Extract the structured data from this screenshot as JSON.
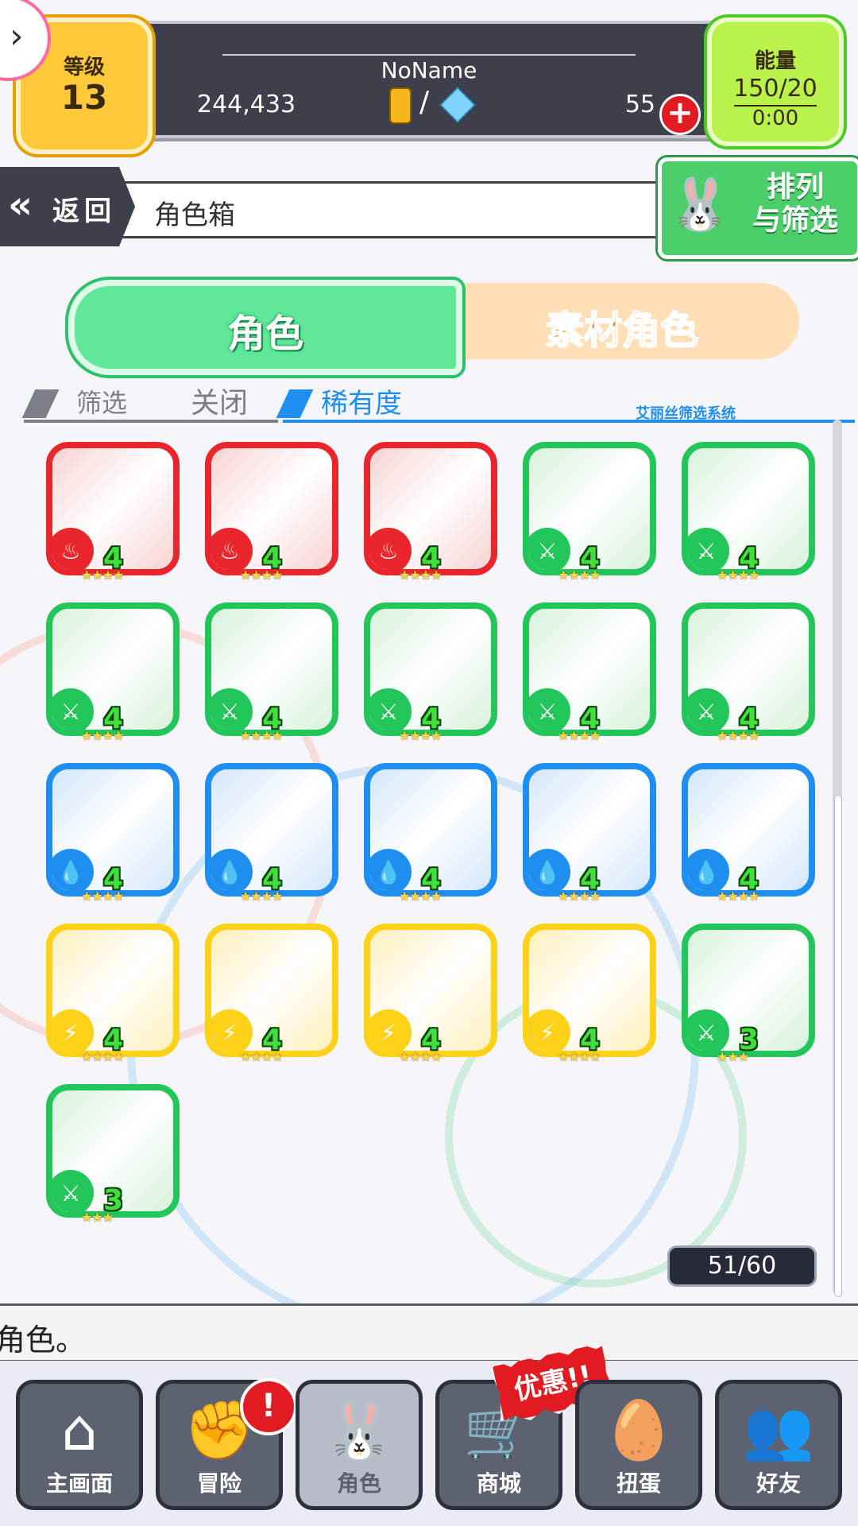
{
  "header": {
    "player_name": "NoName",
    "level_label": "等级",
    "level_value": "13",
    "gold": "244,433",
    "separator": "/",
    "gems": "55",
    "energy_label": "能量",
    "energy_value": "150/20",
    "energy_timer": "0:00"
  },
  "nav": {
    "back_label": "返回",
    "breadcrumb": "角色箱",
    "sort_filter_line1": "排列",
    "sort_filter_line2": "与筛选"
  },
  "tabs": {
    "characters": "角色",
    "material_characters": "素材角色"
  },
  "filter": {
    "filter_label": "筛选",
    "filter_value": "关闭",
    "sort_label": "稀有度",
    "system_label": "艾丽丝筛选系统"
  },
  "colors": {
    "fire": "#e8262c",
    "wood": "#22c65a",
    "water": "#1e8ff0",
    "thunder": "#ffd21a"
  },
  "characters": [
    {
      "element": "fire",
      "level": "4",
      "stars": "★★★★",
      "icon": "fire-element-icon"
    },
    {
      "element": "fire",
      "level": "4",
      "stars": "★★★★",
      "icon": "fire-element-icon"
    },
    {
      "element": "fire",
      "level": "4",
      "stars": "★★★★",
      "icon": "fire-element-icon"
    },
    {
      "element": "wood",
      "level": "4",
      "stars": "★★★★",
      "icon": "wood-element-icon"
    },
    {
      "element": "wood",
      "level": "4",
      "stars": "★★★★",
      "icon": "wood-element-icon"
    },
    {
      "element": "wood",
      "level": "4",
      "stars": "★★★★",
      "icon": "wood-element-icon"
    },
    {
      "element": "wood",
      "level": "4",
      "stars": "★★★★",
      "icon": "wood-element-icon"
    },
    {
      "element": "wood",
      "level": "4",
      "stars": "★★★★",
      "icon": "wood-element-icon"
    },
    {
      "element": "wood",
      "level": "4",
      "stars": "★★★★",
      "icon": "wood-element-icon"
    },
    {
      "element": "wood",
      "level": "4",
      "stars": "★★★★",
      "icon": "wood-element-icon"
    },
    {
      "element": "water",
      "level": "4",
      "stars": "★★★★",
      "icon": "water-element-icon"
    },
    {
      "element": "water",
      "level": "4",
      "stars": "★★★★",
      "icon": "water-element-icon"
    },
    {
      "element": "water",
      "level": "4",
      "stars": "★★★★",
      "icon": "water-element-icon"
    },
    {
      "element": "water",
      "level": "4",
      "stars": "★★★★",
      "icon": "water-element-icon"
    },
    {
      "element": "water",
      "level": "4",
      "stars": "★★★★",
      "icon": "water-element-icon"
    },
    {
      "element": "thunder",
      "level": "4",
      "stars": "★★★★",
      "icon": "thunder-element-icon"
    },
    {
      "element": "thunder",
      "level": "4",
      "stars": "★★★★",
      "icon": "thunder-element-icon"
    },
    {
      "element": "thunder",
      "level": "4",
      "stars": "★★★★",
      "icon": "thunder-element-icon"
    },
    {
      "element": "thunder",
      "level": "4",
      "stars": "★★★★",
      "icon": "thunder-element-icon"
    },
    {
      "element": "wood",
      "level": "3",
      "stars": "★★★",
      "icon": "wood-element-icon"
    },
    {
      "element": "wood",
      "level": "3",
      "stars": "★★★",
      "icon": "wood-element-icon"
    }
  ],
  "box_count": "51/60",
  "message": "角色。",
  "bottom_nav": [
    {
      "label": "主画面",
      "icon": "home-icon"
    },
    {
      "label": "冒险",
      "icon": "fist-bump-icon",
      "badge": "!"
    },
    {
      "label": "角色",
      "icon": "rabbit-icon"
    },
    {
      "label": "商城",
      "icon": "cart-icon",
      "banner": "优惠!!"
    },
    {
      "label": "扭蛋",
      "icon": "egg-icon"
    },
    {
      "label": "好友",
      "icon": "friends-icon"
    }
  ]
}
